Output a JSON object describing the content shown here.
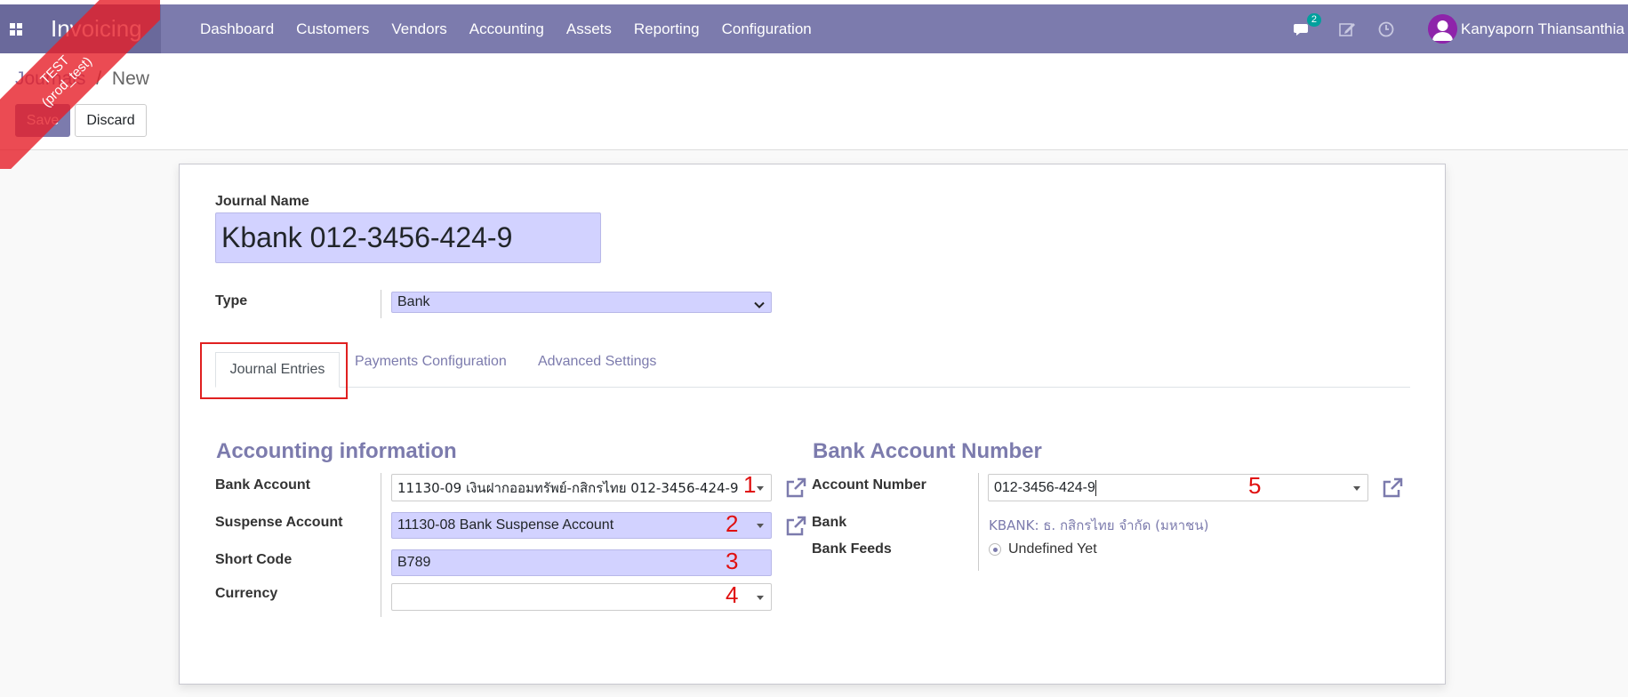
{
  "nav": {
    "brand": "Invoicing",
    "menu": [
      "Dashboard",
      "Customers",
      "Vendors",
      "Accounting",
      "Assets",
      "Reporting",
      "Configuration"
    ],
    "messages_count": "2",
    "user_name": "Kanyaporn Thiansanthia"
  },
  "ribbon": {
    "line1": "TEST",
    "line2": "(prod_test)"
  },
  "breadcrumb": {
    "parent": "Journals",
    "separator": "/",
    "current": "New"
  },
  "buttons": {
    "save": "Save",
    "discard": "Discard"
  },
  "form": {
    "journal_name_label": "Journal Name",
    "journal_name": "Kbank 012-3456-424-9",
    "type_label": "Type",
    "type_value": "Bank",
    "tabs": [
      "Journal Entries",
      "Payments Configuration",
      "Advanced Settings"
    ],
    "accounting": {
      "title": "Accounting information",
      "bank_account_label": "Bank Account",
      "bank_account_value": "11130-09 เงินฝากออมทรัพย์-กสิกรไทย 012-3456-424-9",
      "suspense_account_label": "Suspense Account",
      "suspense_account_value": "11130-08 Bank Suspense Account",
      "short_code_label": "Short Code",
      "short_code_value": "B789",
      "currency_label": "Currency",
      "currency_value": ""
    },
    "bank_account": {
      "title": "Bank Account Number",
      "account_number_label": "Account Number",
      "account_number_value": "012-3456-424-9",
      "bank_label": "Bank",
      "bank_value": "KBANK: ธ. กสิกรไทย จำกัด (มหาชน)",
      "bank_feeds_label": "Bank Feeds",
      "bank_feeds_value": "Undefined Yet"
    }
  },
  "annotations": {
    "n1": "1",
    "n2": "2",
    "n3": "3",
    "n4": "4",
    "n5": "5"
  },
  "colors": {
    "primary": "#7c7bad",
    "input_bg": "#d2d2ff",
    "annotation_red": "#e01010"
  }
}
